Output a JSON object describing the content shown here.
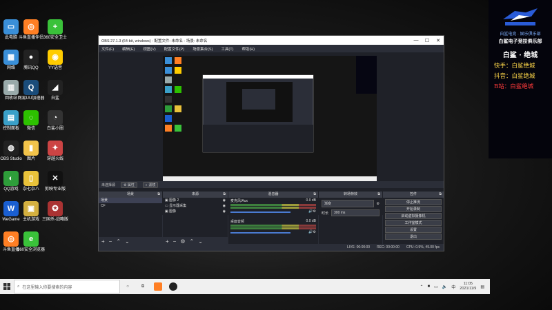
{
  "desktop_icons": [
    {
      "label": "此电脑",
      "icon": "computer-icon",
      "color": "#3a8fd8",
      "glyph": "▭"
    },
    {
      "label": "斗鱼直播伴侣",
      "icon": "douyu-icon",
      "color": "#ff7f24",
      "glyph": "◎"
    },
    {
      "label": "360安全卫士",
      "icon": "360-icon",
      "color": "#3ac23a",
      "glyph": "+"
    },
    {
      "label": "网络",
      "icon": "network-icon",
      "color": "#3a8fd8",
      "glyph": "▦"
    },
    {
      "label": "腾讯QQ",
      "icon": "qq-icon",
      "color": "#222",
      "glyph": "●"
    },
    {
      "label": "YY语音",
      "icon": "yy-icon",
      "color": "#ffcc00",
      "glyph": "◉"
    },
    {
      "label": "回收站",
      "icon": "recycle-bin-icon",
      "color": "#9aa",
      "glyph": "▥"
    },
    {
      "label": "网易UU加速器",
      "icon": "uu-icon",
      "color": "#1a4c7a",
      "glyph": "Q"
    },
    {
      "label": "白鲨",
      "icon": "shark-icon",
      "color": "#222",
      "glyph": "◢"
    },
    {
      "label": "控制面板",
      "icon": "control-panel-icon",
      "color": "#3aa0c8",
      "glyph": "▤"
    },
    {
      "label": "微信",
      "icon": "wechat-icon",
      "color": "#2dc100",
      "glyph": "◌"
    },
    {
      "label": "白鲨小圈",
      "icon": "shark-circle-icon",
      "color": "#333",
      "glyph": "◔"
    },
    {
      "label": "OBS Studio",
      "icon": "obs-icon",
      "color": "#222",
      "glyph": "◍"
    },
    {
      "label": "图片",
      "icon": "folder-icon",
      "color": "#f2c34a",
      "glyph": "▮"
    },
    {
      "label": "穿越火线",
      "icon": "cf-icon",
      "color": "#c44",
      "glyph": "✦"
    },
    {
      "label": "QQ游戏",
      "icon": "qqgame-icon",
      "color": "#2e9e3a",
      "glyph": "◐"
    },
    {
      "label": "杂七杂八",
      "icon": "misc-folder-icon",
      "color": "#e9c23a",
      "glyph": "▯"
    },
    {
      "label": "剪映专业版",
      "icon": "capcut-icon",
      "color": "#111",
      "glyph": "✕"
    },
    {
      "label": "WeGame",
      "icon": "wegame-icon",
      "color": "#1a5fd1",
      "glyph": "W"
    },
    {
      "label": "主机游戏",
      "icon": "console-game-icon",
      "color": "#d4b040",
      "glyph": "▣"
    },
    {
      "label": "三国杀-战略版",
      "icon": "sanguosha-icon",
      "color": "#a33",
      "glyph": "✪"
    },
    {
      "label": "斗鱼直播",
      "icon": "douyu-live-icon",
      "color": "#ff7f24",
      "glyph": "◎"
    },
    {
      "label": "360安全浏览器",
      "icon": "360browser-icon",
      "color": "#3ac23a",
      "glyph": "e"
    }
  ],
  "overlay": {
    "line1": "白鲨电竞 · 娱乐俱乐部",
    "line2": "白鲨电子竞技俱乐部",
    "line3": "白鲨 · 绝城",
    "line4": "快手：白鲨绝城",
    "line5": "抖音：白鲨绝城",
    "line6": "B站：白鲨绝城"
  },
  "obs": {
    "title": "OBS 27.1.3 (64-bit, windows) - 配置文件: 未命名 - 场景: 未命名",
    "menu": [
      "文件(F)",
      "编辑(E)",
      "视图(V)",
      "配置文件(P)",
      "场景集合(S)",
      "工具(T)",
      "帮助(H)"
    ],
    "context_label": "未选择源",
    "properties_btn": "属性",
    "filters_btn": "滤镜",
    "docks": {
      "scenes": {
        "title": "场景",
        "items": [
          "场景",
          "CF"
        ]
      },
      "sources": {
        "title": "来源",
        "items": [
          "图像 2",
          "显示器采集",
          "图像"
        ]
      },
      "mixer": {
        "title": "混音器",
        "tracks": [
          {
            "name": "麦克风/Aux",
            "db": "0.0 dB"
          },
          {
            "name": "桌面音频",
            "db": "0.0 dB"
          }
        ]
      },
      "transitions": {
        "title": "转场特效",
        "type": "渐变",
        "duration_label": "时长",
        "duration": "300 ms"
      },
      "controls": {
        "title": "控件",
        "buttons": [
          "停止推流",
          "开始录制",
          "启动虚拟摄像机",
          "工作室模式",
          "设置",
          "退出"
        ]
      }
    },
    "status": {
      "live": "LIVE: 00:00:00",
      "rec": "REC: 00:00:00",
      "cpu": "CPU: 0.9%, 49.00 fps"
    }
  },
  "taskbar": {
    "search_placeholder": "在这里输入你要搜索的内容",
    "time": "11:05",
    "date": "2021/11/9"
  }
}
